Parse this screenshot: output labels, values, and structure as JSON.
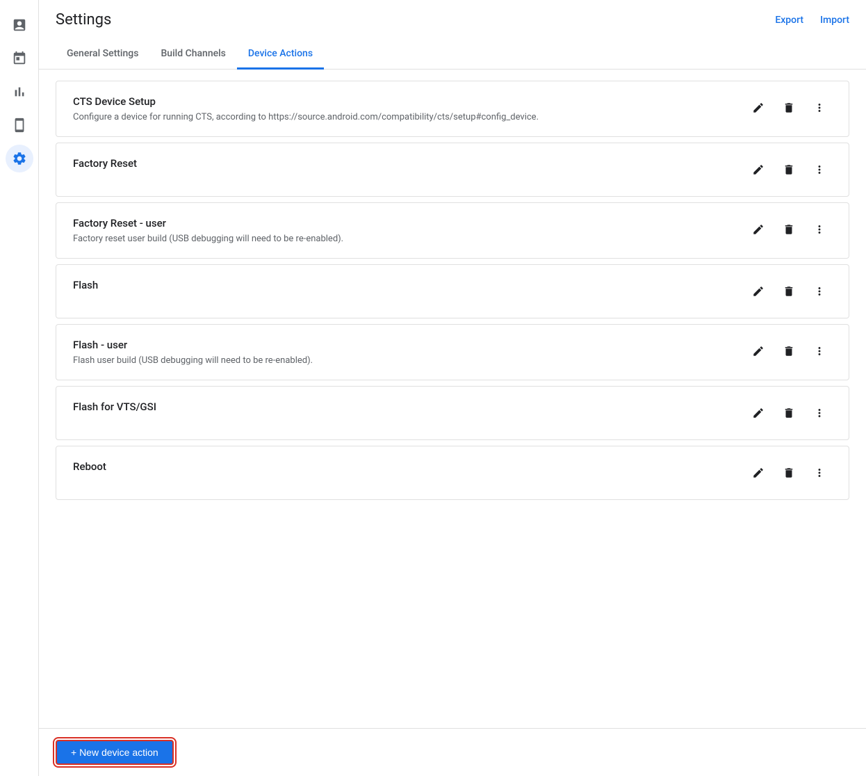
{
  "header": {
    "title": "Settings",
    "export_label": "Export",
    "import_label": "Import"
  },
  "tabs": [
    {
      "id": "general",
      "label": "General Settings",
      "active": false
    },
    {
      "id": "build_channels",
      "label": "Build Channels",
      "active": false
    },
    {
      "id": "device_actions",
      "label": "Device Actions",
      "active": true
    }
  ],
  "sidebar": {
    "items": [
      {
        "id": "reports",
        "icon": "📋",
        "label": "Reports"
      },
      {
        "id": "calendar",
        "icon": "📅",
        "label": "Calendar"
      },
      {
        "id": "analytics",
        "icon": "📊",
        "label": "Analytics"
      },
      {
        "id": "device",
        "icon": "📱",
        "label": "Device"
      },
      {
        "id": "settings",
        "icon": "⚙",
        "label": "Settings",
        "active": true
      }
    ]
  },
  "actions": [
    {
      "id": "cts-device-setup",
      "title": "CTS Device Setup",
      "description": "Configure a device for running CTS, according to https://source.android.com/compatibility/cts/setup#config_device."
    },
    {
      "id": "factory-reset",
      "title": "Factory Reset",
      "description": ""
    },
    {
      "id": "factory-reset-user",
      "title": "Factory Reset - user",
      "description": "Factory reset user build (USB debugging will need to be re-enabled)."
    },
    {
      "id": "flash",
      "title": "Flash",
      "description": ""
    },
    {
      "id": "flash-user",
      "title": "Flash - user",
      "description": "Flash user build (USB debugging will need to be re-enabled)."
    },
    {
      "id": "flash-vts-gsi",
      "title": "Flash for VTS/GSI",
      "description": ""
    },
    {
      "id": "reboot",
      "title": "Reboot",
      "description": ""
    }
  ],
  "footer": {
    "new_action_label": "+ New device action"
  }
}
